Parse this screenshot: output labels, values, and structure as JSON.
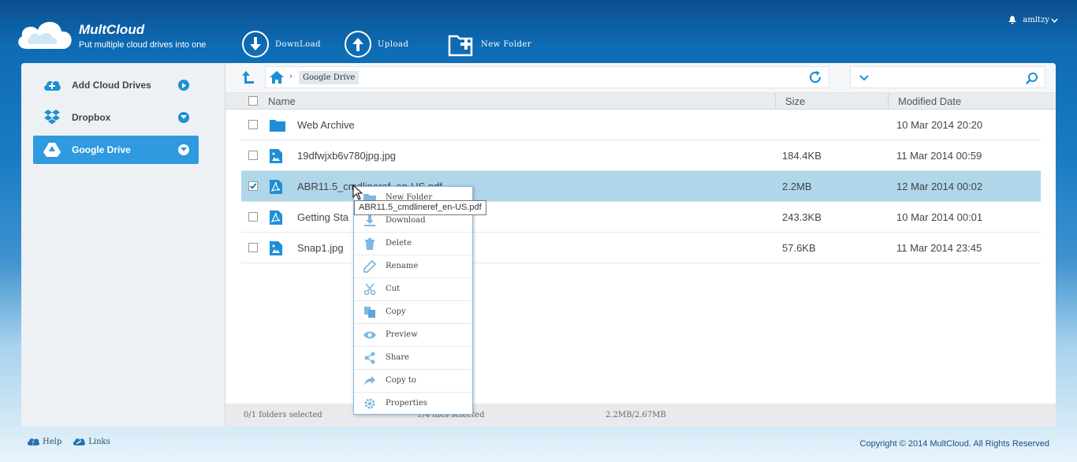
{
  "header": {
    "brand": "MultCloud",
    "tagline": "Put multiple cloud drives into one",
    "buttons": [
      {
        "label": "DownLoad",
        "icon": "download-circle-icon"
      },
      {
        "label": "Upload",
        "icon": "upload-circle-icon"
      },
      {
        "label": "New Folder",
        "icon": "new-folder-icon"
      }
    ],
    "username": "amltzy"
  },
  "sidebar": {
    "items": [
      {
        "label": "Add Cloud Drives",
        "icon": "add-cloud-icon"
      },
      {
        "label": "Dropbox",
        "icon": "dropbox-icon"
      },
      {
        "label": "Google Drive",
        "icon": "google-drive-icon",
        "active": true
      }
    ]
  },
  "breadcrumb": {
    "current": "Google Drive"
  },
  "table": {
    "columns": {
      "name": "Name",
      "size": "Size",
      "modified": "Modified Date"
    },
    "rows": [
      {
        "name": "Web Archive",
        "size": "",
        "modified": "10 Mar 2014 20:20",
        "type": "folder"
      },
      {
        "name": "19dfwjxb6v780jpg.jpg",
        "size": "184.4KB",
        "modified": "11 Mar 2014 00:59",
        "type": "image"
      },
      {
        "name": "ABR11.5_cmdlineref_en-US.pdf",
        "size": "2.2MB",
        "modified": "12 Mar 2014 00:02",
        "type": "pdf",
        "selected": true
      },
      {
        "name": "Getting Sta",
        "size": "243.3KB",
        "modified": "10 Mar 2014 00:01",
        "type": "pdf"
      },
      {
        "name": "Snap1.jpg",
        "size": "57.6KB",
        "modified": "11 Mar 2014 23:45",
        "type": "image"
      }
    ]
  },
  "status": {
    "folders": "0/1 folders selected",
    "files": "1/4 files selected",
    "size": "2.2MB/2.67MB"
  },
  "context_menu": {
    "items": [
      "New Folder",
      "Download",
      "Delete",
      "Rename",
      "Cut",
      "Copy",
      "Preview",
      "Share",
      "Copy to",
      "Properties"
    ]
  },
  "tooltip": "ABR11.5_cmdlineref_en-US.pdf",
  "footer": {
    "help": "Help",
    "links": "Links",
    "copyright": "Copyright © 2014 MultCloud. All Rights Reserved"
  },
  "colors": {
    "accent": "#2f9ae0",
    "selected_row": "#b0d6ea",
    "icon_blue": "#1e8fd6"
  }
}
